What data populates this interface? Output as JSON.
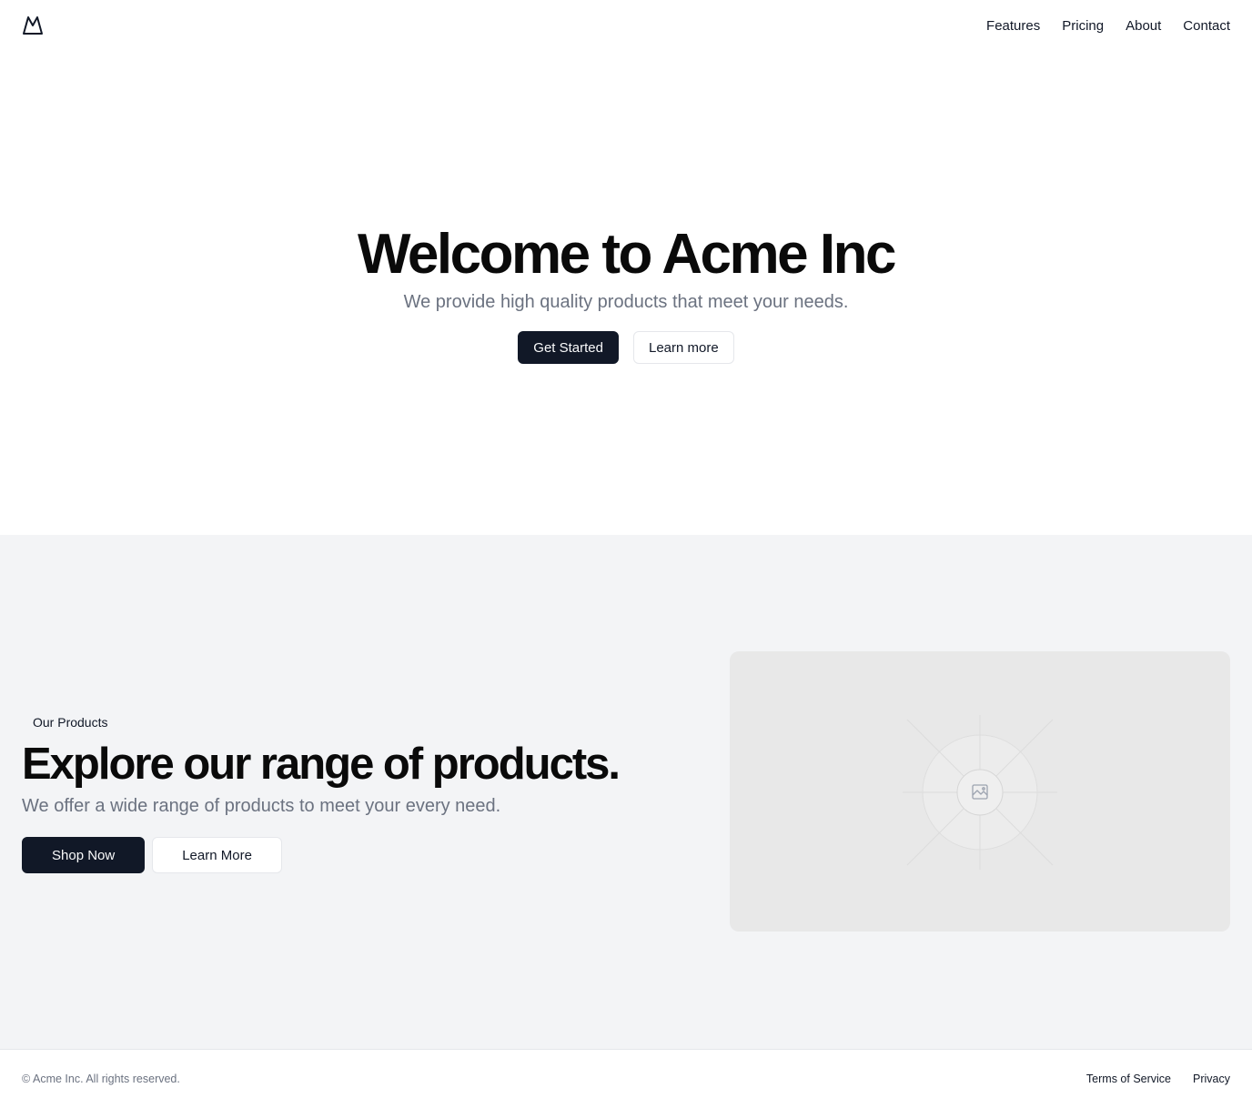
{
  "header": {
    "logo_icon": "mountain-icon",
    "nav": [
      {
        "label": "Features"
      },
      {
        "label": "Pricing"
      },
      {
        "label": "About"
      },
      {
        "label": "Contact"
      }
    ]
  },
  "hero": {
    "title": "Welcome to Acme Inc",
    "subtitle": "We provide high quality products that meet your needs.",
    "primary_button": "Get Started",
    "secondary_button": "Learn more"
  },
  "products": {
    "badge": "Our Products",
    "title": "Explore our range of products.",
    "subtitle": "We offer a wide range of products to meet your every need.",
    "primary_button": "Shop Now",
    "secondary_button": "Learn More",
    "image_icon": "image-placeholder-icon"
  },
  "footer": {
    "copyright": "© Acme Inc. All rights reserved.",
    "links": [
      {
        "label": "Terms of Service"
      },
      {
        "label": "Privacy"
      }
    ]
  },
  "colors": {
    "dark_button": "#111827",
    "muted_text": "#6b7280",
    "section_background": "#f3f4f6",
    "image_background": "#e8e8e8"
  }
}
